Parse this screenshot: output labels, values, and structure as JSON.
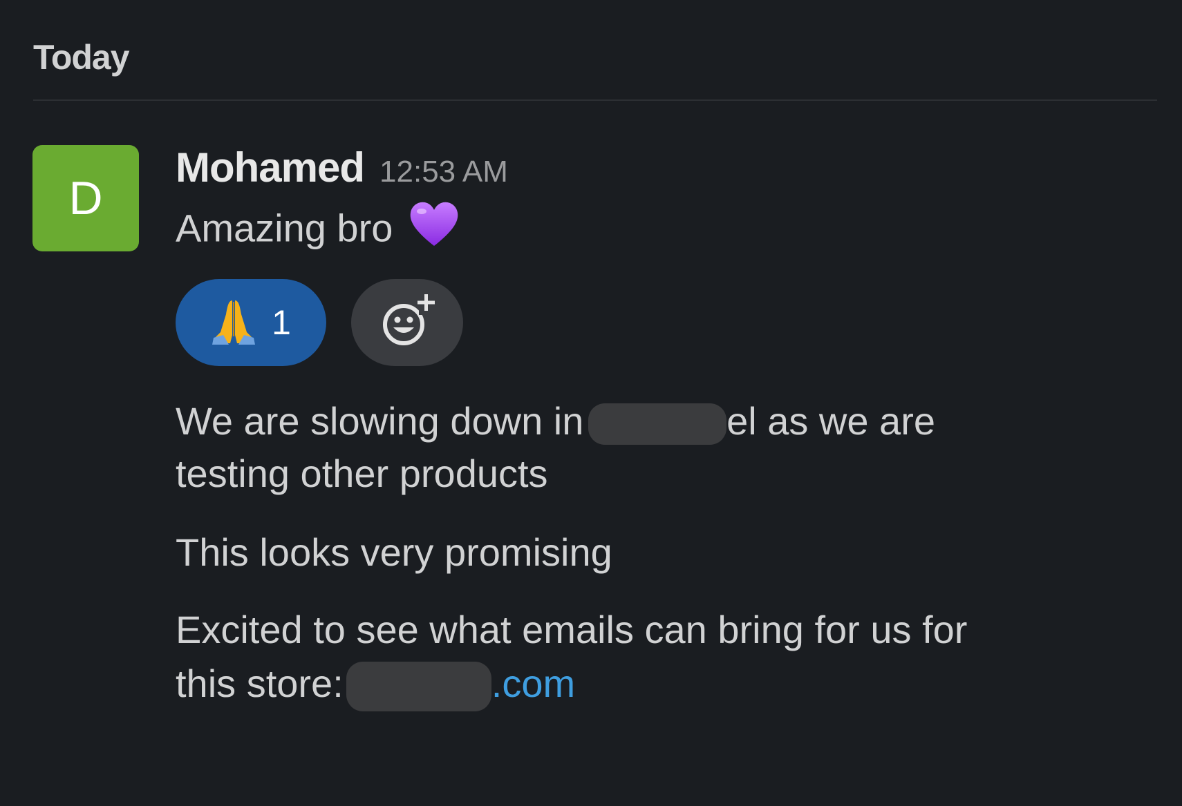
{
  "day_divider": {
    "label": "Today"
  },
  "message": {
    "avatar_initial": "D",
    "author": "Mohamed",
    "timestamp": "12:53 AM",
    "first_text": "Amazing bro",
    "first_emoji": "purple-heart-icon",
    "reactions": [
      {
        "emoji": "folded-hands-icon",
        "count": "1"
      }
    ],
    "add_reaction_icon": "add-reaction-icon",
    "lines": {
      "slowing_start": "We are slowing down in ..",
      "slowing_end": "el as we are",
      "testing": "testing other products",
      "promising": "This looks very promising",
      "excited": "Excited to see what emails  can bring for us for",
      "store_prefix": "this store:",
      "store_link_suffix": ".com"
    }
  },
  "colors": {
    "background": "#1a1d21",
    "avatar": "#6aab31",
    "reaction_active": "#1e5aa0",
    "link": "#3f9ee0"
  }
}
